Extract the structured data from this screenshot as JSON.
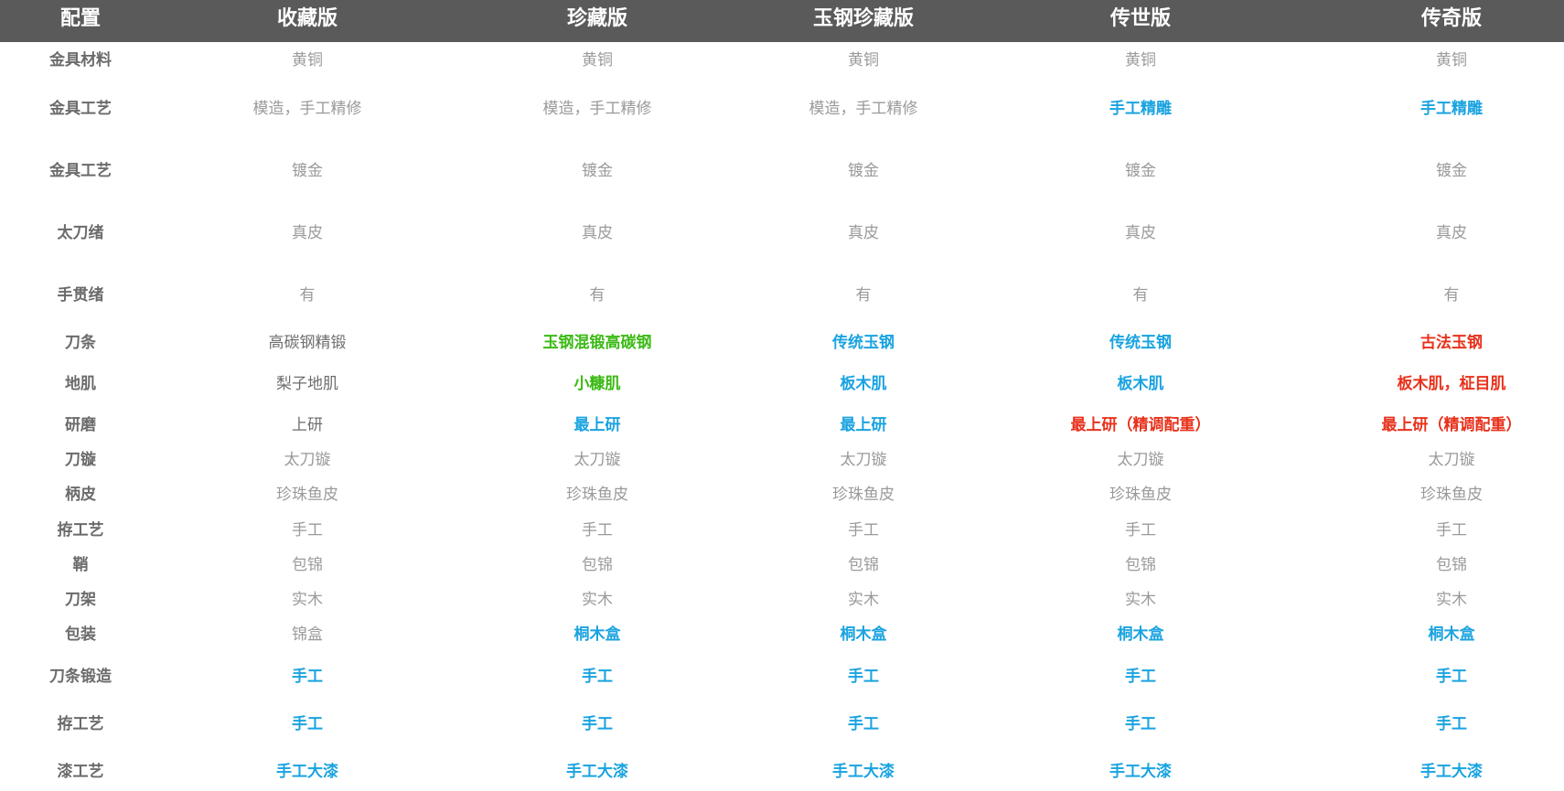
{
  "headers": [
    "配置",
    "收藏版",
    "珍藏版",
    "玉钢珍藏版",
    "传世版",
    "传奇版"
  ],
  "rows": [
    {
      "label": "金具材料",
      "cells": [
        {
          "text": "黄铜",
          "style": "plain"
        },
        {
          "text": "黄铜",
          "style": "plain"
        },
        {
          "text": "黄铜",
          "style": "plain"
        },
        {
          "text": "黄铜",
          "style": "plain"
        },
        {
          "text": "黄铜",
          "style": "plain"
        }
      ]
    },
    {
      "label": "金具工艺",
      "cells": [
        {
          "text": "模造，手工精修",
          "style": "plain"
        },
        {
          "text": "模造，手工精修",
          "style": "plain"
        },
        {
          "text": "模造，手工精修",
          "style": "plain"
        },
        {
          "text": "手工精雕",
          "style": "blue"
        },
        {
          "text": "手工精雕",
          "style": "blue"
        }
      ]
    },
    {
      "label": "金具工艺",
      "cells": [
        {
          "text": "镀金",
          "style": "plain"
        },
        {
          "text": "镀金",
          "style": "plain"
        },
        {
          "text": "镀金",
          "style": "plain"
        },
        {
          "text": "镀金",
          "style": "plain"
        },
        {
          "text": "镀金",
          "style": "plain"
        }
      ]
    },
    {
      "label": "太刀绪",
      "cells": [
        {
          "text": "真皮",
          "style": "plain"
        },
        {
          "text": "真皮",
          "style": "plain"
        },
        {
          "text": "真皮",
          "style": "plain"
        },
        {
          "text": "真皮",
          "style": "plain"
        },
        {
          "text": "真皮",
          "style": "plain"
        }
      ]
    },
    {
      "label": "手贯绪",
      "cells": [
        {
          "text": "有",
          "style": "plain"
        },
        {
          "text": "有",
          "style": "plain"
        },
        {
          "text": "有",
          "style": "plain"
        },
        {
          "text": "有",
          "style": "plain"
        },
        {
          "text": "有",
          "style": "plain"
        }
      ]
    },
    {
      "label": "刀条",
      "cells": [
        {
          "text": "高碳钢精锻",
          "style": "dark"
        },
        {
          "text": "玉钢混锻高碳钢",
          "style": "green"
        },
        {
          "text": "传统玉钢",
          "style": "blue"
        },
        {
          "text": "传统玉钢",
          "style": "blue"
        },
        {
          "text": "古法玉钢",
          "style": "red"
        }
      ]
    },
    {
      "label": "地肌",
      "cells": [
        {
          "text": "梨子地肌",
          "style": "dark"
        },
        {
          "text": "小糠肌",
          "style": "green"
        },
        {
          "text": "板木肌",
          "style": "blue"
        },
        {
          "text": "板木肌",
          "style": "blue"
        },
        {
          "text": "板木肌，柾目肌",
          "style": "red"
        }
      ]
    },
    {
      "label": "研磨",
      "cells": [
        {
          "text": "上研",
          "style": "dark"
        },
        {
          "text": "最上研",
          "style": "blue"
        },
        {
          "text": "最上研",
          "style": "blue"
        },
        {
          "text": "最上研（精调配重）",
          "style": "red"
        },
        {
          "text": "最上研（精调配重）",
          "style": "red"
        }
      ]
    },
    {
      "label": "刀镟",
      "cells": [
        {
          "text": "太刀镟",
          "style": "plain"
        },
        {
          "text": "太刀镟",
          "style": "plain"
        },
        {
          "text": "太刀镟",
          "style": "plain"
        },
        {
          "text": "太刀镟",
          "style": "plain"
        },
        {
          "text": "太刀镟",
          "style": "plain"
        }
      ]
    },
    {
      "label": "柄皮",
      "cells": [
        {
          "text": "珍珠鱼皮",
          "style": "plain"
        },
        {
          "text": "珍珠鱼皮",
          "style": "plain"
        },
        {
          "text": "珍珠鱼皮",
          "style": "plain"
        },
        {
          "text": "珍珠鱼皮",
          "style": "plain"
        },
        {
          "text": "珍珠鱼皮",
          "style": "plain"
        }
      ]
    },
    {
      "label": "拵工艺",
      "cells": [
        {
          "text": "手工",
          "style": "plain"
        },
        {
          "text": "手工",
          "style": "plain"
        },
        {
          "text": "手工",
          "style": "plain"
        },
        {
          "text": "手工",
          "style": "plain"
        },
        {
          "text": "手工",
          "style": "plain"
        }
      ]
    },
    {
      "label": "鞘",
      "cells": [
        {
          "text": "包锦",
          "style": "plain"
        },
        {
          "text": "包锦",
          "style": "plain"
        },
        {
          "text": "包锦",
          "style": "plain"
        },
        {
          "text": "包锦",
          "style": "plain"
        },
        {
          "text": "包锦",
          "style": "plain"
        }
      ]
    },
    {
      "label": "刀架",
      "cells": [
        {
          "text": "实木",
          "style": "plain"
        },
        {
          "text": "实木",
          "style": "plain"
        },
        {
          "text": "实木",
          "style": "plain"
        },
        {
          "text": "实木",
          "style": "plain"
        },
        {
          "text": "实木",
          "style": "plain"
        }
      ]
    },
    {
      "label": "包装",
      "cells": [
        {
          "text": "锦盒",
          "style": "plain"
        },
        {
          "text": "桐木盒",
          "style": "blue"
        },
        {
          "text": "桐木盒",
          "style": "blue"
        },
        {
          "text": "桐木盒",
          "style": "blue"
        },
        {
          "text": "桐木盒",
          "style": "blue"
        }
      ]
    },
    {
      "label": "刀条锻造",
      "cells": [
        {
          "text": "手工",
          "style": "blue"
        },
        {
          "text": "手工",
          "style": "blue"
        },
        {
          "text": "手工",
          "style": "blue"
        },
        {
          "text": "手工",
          "style": "blue"
        },
        {
          "text": "手工",
          "style": "blue"
        }
      ]
    },
    {
      "label": "拵工艺",
      "cells": [
        {
          "text": "手工",
          "style": "blue"
        },
        {
          "text": "手工",
          "style": "blue"
        },
        {
          "text": "手工",
          "style": "blue"
        },
        {
          "text": "手工",
          "style": "blue"
        },
        {
          "text": "手工",
          "style": "blue"
        }
      ]
    },
    {
      "label": "漆工艺",
      "cells": [
        {
          "text": "手工大漆",
          "style": "blue"
        },
        {
          "text": "手工大漆",
          "style": "blue"
        },
        {
          "text": "手工大漆",
          "style": "blue"
        },
        {
          "text": "手工大漆",
          "style": "blue"
        },
        {
          "text": "手工大漆",
          "style": "blue"
        }
      ]
    }
  ],
  "colors": {
    "header_bg": "#5a5a5a",
    "label": "#6b6b6b",
    "plain": "#9a9a9a",
    "dark": "#6e6e6e",
    "blue": "#1aa3e0",
    "green": "#3cba16",
    "red": "#e8321c"
  }
}
